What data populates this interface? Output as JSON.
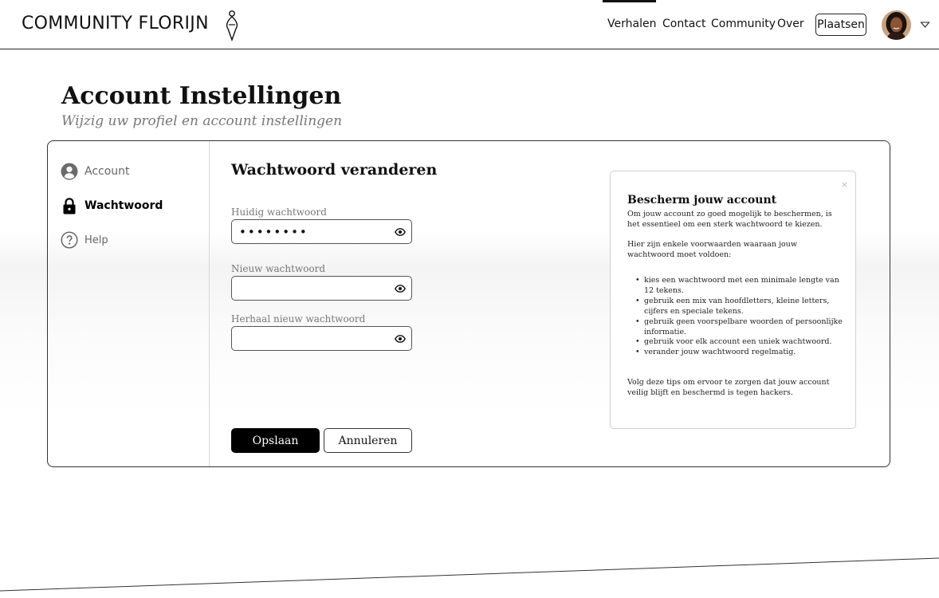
{
  "header": {
    "brand": "COMMUNITY FLORIJN",
    "nav": [
      {
        "label": "Verhalen",
        "active": true
      },
      {
        "label": "Contact",
        "active": false
      },
      {
        "label": "Community",
        "active": false
      },
      {
        "label": "Over",
        "active": false
      }
    ],
    "post_button": "Plaatsen",
    "avatar_icon": "user-avatar",
    "menu_icon": "chevron-down-icon"
  },
  "page": {
    "title": "Account Instellingen",
    "subtitle": "Wijzig uw profiel en account instellingen"
  },
  "sidebar": {
    "items": [
      {
        "label": "Account",
        "icon": "user-circle-icon",
        "active": false
      },
      {
        "label": "Wachtwoord",
        "icon": "lock-icon",
        "active": true
      },
      {
        "label": "Help",
        "icon": "help-icon",
        "active": false
      }
    ]
  },
  "form": {
    "title": "Wachtwoord veranderen",
    "fields": [
      {
        "label": "Huidig wachtwoord",
        "value": "••••••••",
        "placeholder": ""
      },
      {
        "label": "Nieuw wachtwoord",
        "value": "",
        "placeholder": ""
      },
      {
        "label": "Herhaal nieuw wachtwoord",
        "value": "",
        "placeholder": ""
      }
    ],
    "save_label": "Opslaan",
    "cancel_label": "Annuleren"
  },
  "tip": {
    "close": "×",
    "title": "Bescherm jouw account",
    "intro": "Om jouw account zo goed mogelijk te beschermen, is het essentieel om een sterk wachtwoord te kiezen.",
    "requirements_intro": "Hier zijn enkele voorwaarden waaraan jouw wachtwoord moet voldoen:",
    "list": [
      "kies een wachtwoord met een minimale lengte van 12 tekens.",
      "gebruik een mix van hoofdletters, kleine letters, cijfers en speciale tekens.",
      "gebruik geen voorspelbare woorden of persoonlijke informatie.",
      "gebruik voor elk account een uniek wachtwoord.",
      "verander jouw wachtwoord regelmatig."
    ],
    "outro": "Volg deze tips om ervoor te zorgen dat jouw account veilig blijft en beschermd is tegen hackers."
  },
  "colors": {
    "accent": "#000000",
    "border": "#333333",
    "muted_text": "#777777"
  }
}
